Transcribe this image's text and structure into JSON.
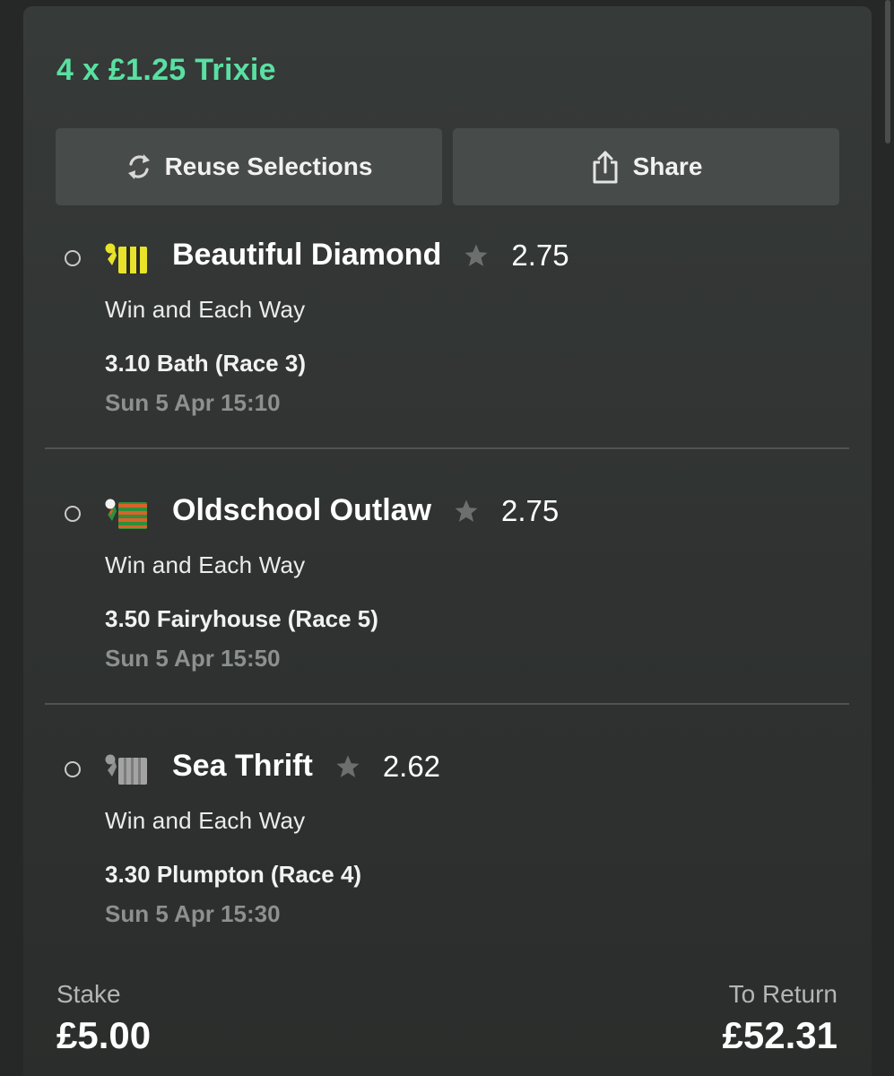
{
  "bet": {
    "title": "4 x £1.25 Trixie",
    "accent_color": "#59e0a2"
  },
  "actions": {
    "reuse_label": "Reuse Selections",
    "reuse_icon": "refresh-icon",
    "share_label": "Share",
    "share_icon": "share-icon"
  },
  "selections": [
    {
      "runner": "Beautiful Diamond",
      "odds": "2.75",
      "market": "Win and Each Way",
      "race": "3.10 Bath (Race 3)",
      "time": "Sun 5 Apr 15:10",
      "silk_colors": [
        "#e8e22a",
        "#2a2a2a"
      ]
    },
    {
      "runner": "Oldschool Outlaw",
      "odds": "2.75",
      "market": "Win and Each Way",
      "race": "3.50 Fairyhouse (Race 5)",
      "time": "Sun 5 Apr 15:50",
      "silk_colors": [
        "#d9622b",
        "#2f8f3a"
      ]
    },
    {
      "runner": "Sea Thrift",
      "odds": "2.62",
      "market": "Win and Each Way",
      "race": "3.30 Plumpton (Race 4)",
      "time": "Sun 5 Apr 15:30",
      "silk_colors": [
        "#9a9a9a",
        "#b8b8b8"
      ]
    }
  ],
  "summary": {
    "stake_label": "Stake",
    "stake_value": "£5.00",
    "return_label": "To Return",
    "return_value": "£52.31"
  }
}
